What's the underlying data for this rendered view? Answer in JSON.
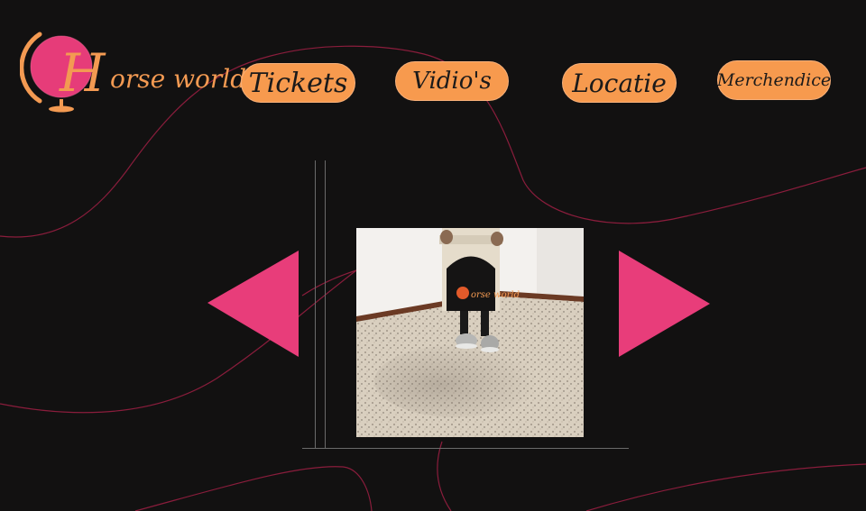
{
  "logo": {
    "initial": "H",
    "rest": "orse world",
    "icon": "globe-icon"
  },
  "nav": {
    "tickets": "Tickets",
    "videos": "Vidio's",
    "locatie": "Locatie",
    "merchandise": "Merchendice"
  },
  "carousel": {
    "prev_icon": "triangle-left-icon",
    "next_icon": "triangle-right-icon",
    "bag_brand": "orse world"
  },
  "colors": {
    "background": "#121111",
    "accent_orange": "#f79a4e",
    "accent_pink": "#e83d7a",
    "curve": "#8a1d3c"
  }
}
